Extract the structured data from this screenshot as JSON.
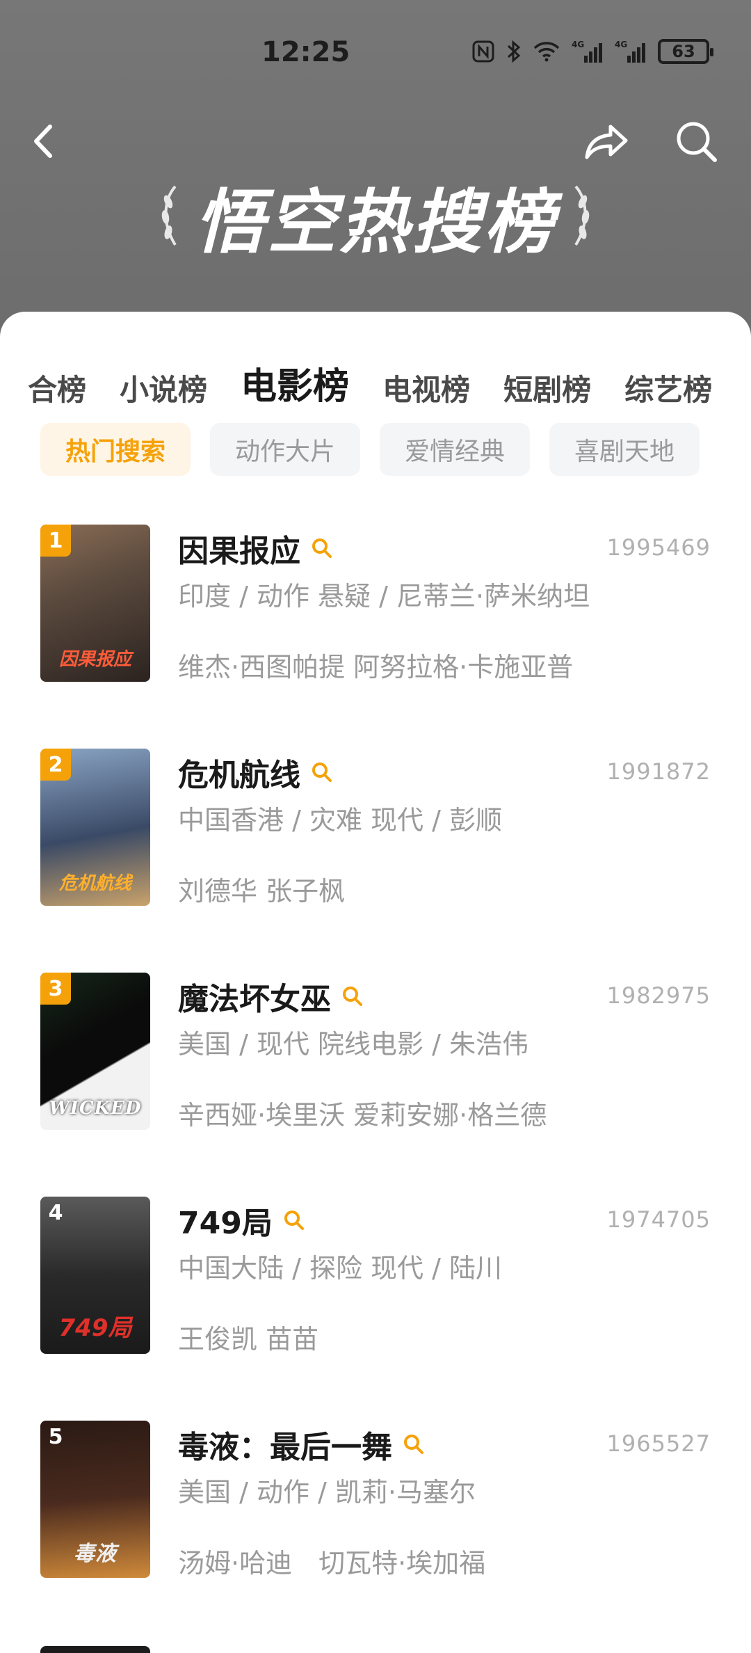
{
  "status": {
    "time": "12:25",
    "battery": "63"
  },
  "header": {
    "title": "悟空热搜榜"
  },
  "tabs": [
    {
      "label": "合榜"
    },
    {
      "label": "小说榜"
    },
    {
      "label": "电影榜"
    },
    {
      "label": "电视榜"
    },
    {
      "label": "短剧榜"
    },
    {
      "label": "综艺榜"
    }
  ],
  "active_tab": "电影榜",
  "chips": [
    {
      "label": "热门搜索"
    },
    {
      "label": "动作大片"
    },
    {
      "label": "爱情经典"
    },
    {
      "label": "喜剧天地"
    }
  ],
  "active_chip": "热门搜索",
  "movies": [
    {
      "rank": "1",
      "title": "因果报应",
      "heat": "1995469",
      "meta": "印度 / 动作 悬疑 / 尼蒂兰·萨米纳坦",
      "cast": "维杰·西图帕提 阿努拉格·卡施亚普",
      "poster_text": "因果报应",
      "poster_colors": [
        "#5b4a3e",
        "#2b2320",
        "#8a6d55"
      ]
    },
    {
      "rank": "2",
      "title": "危机航线",
      "heat": "1991872",
      "meta": "中国香港 / 灾难 现代 / 彭顺",
      "cast": "刘德华 张子枫",
      "poster_text": "危机航线",
      "poster_colors": [
        "#8aa4c4",
        "#3a4a66",
        "#c9a26a"
      ]
    },
    {
      "rank": "3",
      "title": "魔法坏女巫",
      "heat": "1982975",
      "meta": "美国 / 现代 院线电影 / 朱浩伟",
      "cast": "辛西娅·埃里沃 爱莉安娜·格兰德",
      "poster_text": "WICKED",
      "poster_colors": [
        "#0b0b0b",
        "#16281a",
        "#6fbf3a"
      ]
    },
    {
      "rank": "4",
      "title": "749局",
      "heat": "1974705",
      "meta": "中国大陆 / 探险 现代 / 陆川",
      "cast": "王俊凯 苗苗",
      "poster_text": "749局",
      "poster_colors": [
        "#3b3b3b",
        "#1a1a1a",
        "#b3261e"
      ]
    },
    {
      "rank": "5",
      "title": "毒液：最后一舞",
      "heat": "1965527",
      "meta": "美国 / 动作 / 凯莉·马塞尔",
      "cast": "汤姆·哈迪　切瓦特·埃加福",
      "poster_text": "毒液",
      "poster_colors": [
        "#7a4a2a",
        "#2a1a14",
        "#d08a3a"
      ]
    }
  ]
}
